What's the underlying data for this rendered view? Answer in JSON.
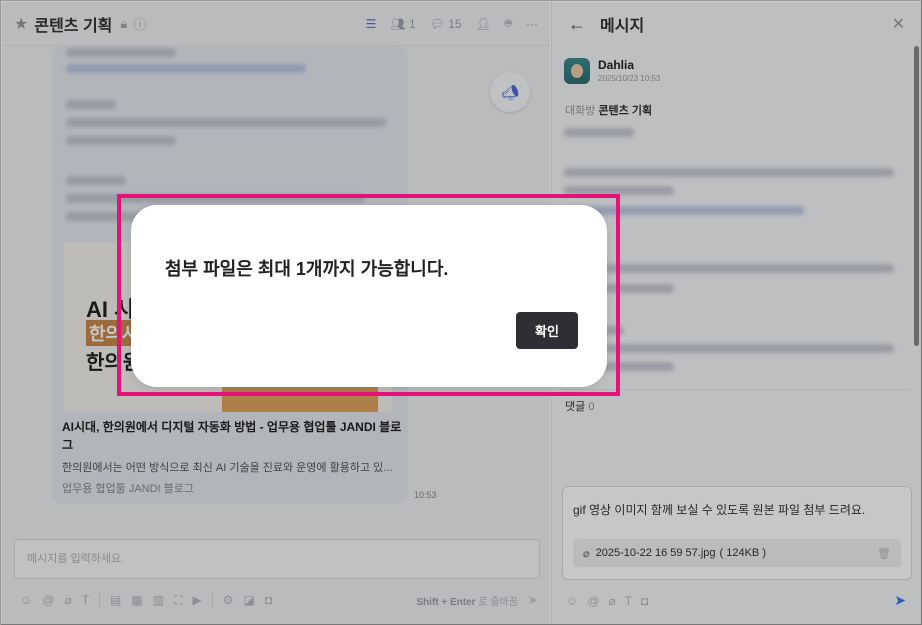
{
  "left": {
    "room_title": "콘텐츠 기획",
    "member_count": "1",
    "topic_count": "15",
    "card": {
      "link_title": "AI시대, 한의원에서 디지털 자동화 방법 - 업무용 협업툴 JANDI 블로그",
      "link_desc": "한의원에서는 어떤 방식으로 최신 AI 기술을 진료와 운영에 활용하고 있...",
      "link_source": "업무용 협업툴 JANDI 블로그",
      "time": "10:53",
      "image_line1": "AI 시",
      "image_line2": "한의사",
      "image_line3": "한의원"
    },
    "input_placeholder": "메시지를 입력하세요.",
    "shortcut_key": "Shift + Enter",
    "shortcut_text": " 로 줄바꿈"
  },
  "right": {
    "title": "메시지",
    "author_name": "Dahlia",
    "author_time": "2025/10/23 10:53",
    "room_label": "대화방",
    "room_name": "콘텐츠 기획",
    "comment_label": "댓글",
    "comment_count": "0",
    "reply_text": "gif 영상 이미지 함께 보실 수 있도록 원본 파일 첨부 드려요.",
    "file_name": "2025-10-22 16 59 57.jpg",
    "file_size": "( 124KB )"
  },
  "dialog": {
    "message": "첨부 파일은 최대 1개까지 가능합니다.",
    "confirm_label": "확인"
  },
  "colors": {
    "highlight": "#e6127a",
    "confirm_bg": "#2f2f33",
    "accent": "#5b6cf0",
    "send": "#3b78e7"
  }
}
